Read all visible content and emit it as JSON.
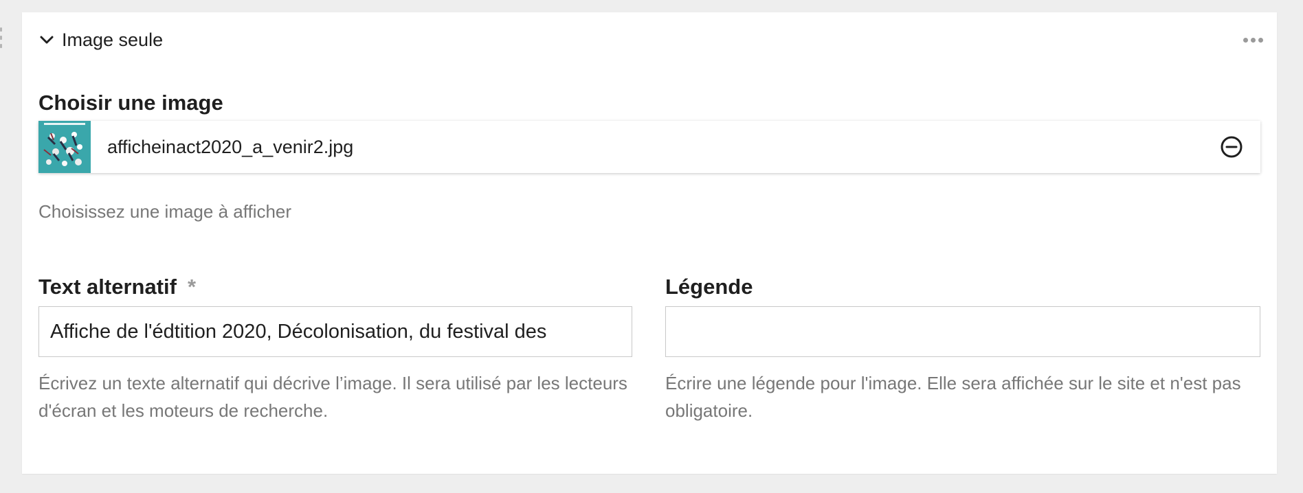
{
  "block": {
    "title": "Image seule",
    "icons": {
      "collapse": "chevron-down-icon",
      "more": "more-horizontal-icon",
      "remove": "minus-circle-icon",
      "drag": "drag-handle-icon"
    }
  },
  "image_field": {
    "label": "Choisir une image",
    "file_name": "afficheinact2020_a_venir2.jpg",
    "help": "Choisissez une image à afficher"
  },
  "alt_field": {
    "label": "Text alternatif",
    "required_marker": "*",
    "value": "Affiche de l'édtition 2020, Décolonisation, du festival des",
    "help": "Écrivez un texte alternatif qui décrive l’image. Il sera utilisé par les lecteurs d'écran et les moteurs de recherche."
  },
  "caption_field": {
    "label": "Légende",
    "value": "",
    "placeholder": "",
    "help": "Écrire une légende pour l'image. Elle sera affichée sur le site et n'est pas obligatoire."
  },
  "colors": {
    "background": "#eeeeee",
    "panel": "#ffffff",
    "text": "#1f1f1f",
    "help_text": "#777777",
    "thumbnail": "#3aa7ab"
  }
}
